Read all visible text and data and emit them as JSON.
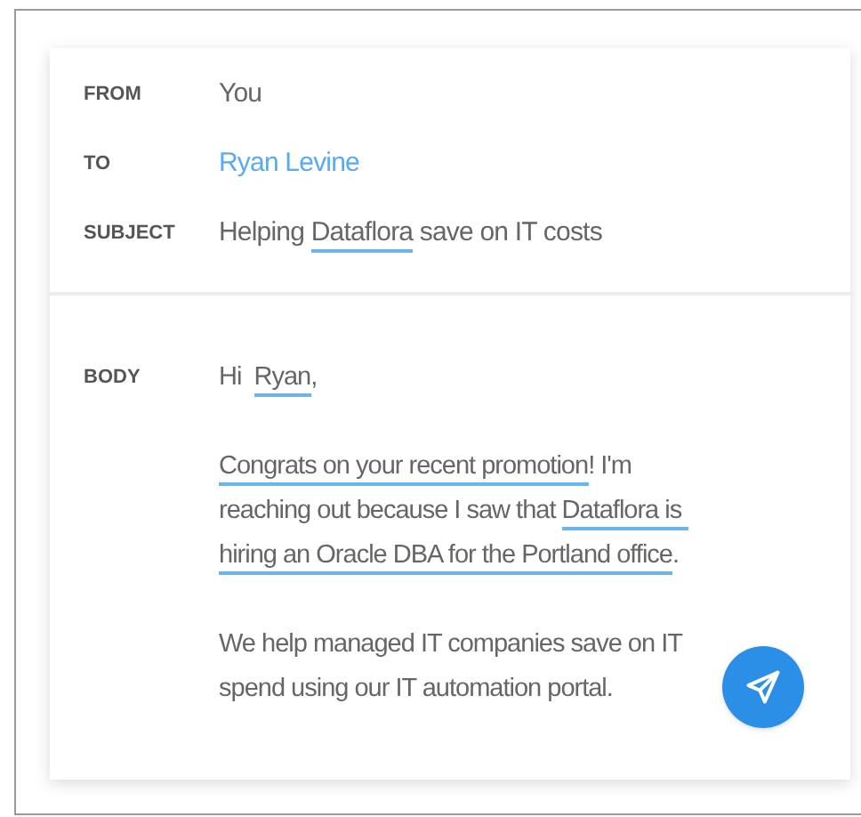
{
  "header_fields": [
    {
      "label": "FROM",
      "kind": "plain",
      "value": [
        {
          "text": "You",
          "underlined": false
        }
      ]
    },
    {
      "label": "TO",
      "kind": "recipient",
      "value": [
        {
          "text": "Ryan Levine",
          "underlined": false
        }
      ]
    },
    {
      "label": "SUBJECT",
      "kind": "plain",
      "value": [
        {
          "text": "Helping ",
          "underlined": false
        },
        {
          "text": "Dataflora",
          "underlined": true
        },
        {
          "text": " save on IT costs",
          "underlined": false
        }
      ]
    }
  ],
  "body": {
    "label": "BODY",
    "paragraphs": [
      [
        {
          "text": "Hi  ",
          "underlined": false
        },
        {
          "text": "Ryan",
          "underlined": true
        },
        {
          "text": ",",
          "underlined": false
        }
      ],
      [
        {
          "text": "Congrats on your recent promotion",
          "underlined": true
        },
        {
          "text": "! I'm reaching out because I saw that ",
          "underlined": false
        },
        {
          "text": "Dataflora is hiring an Oracle DBA for the Portland office",
          "underlined": true
        },
        {
          "text": ".",
          "underlined": false
        }
      ],
      [
        {
          "text": "We help managed IT companies save on IT spend using our IT automation portal.",
          "underlined": false
        }
      ]
    ]
  }
}
